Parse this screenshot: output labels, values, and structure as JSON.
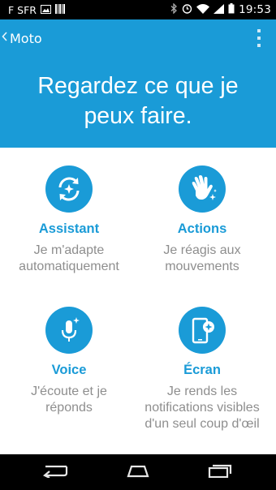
{
  "status_bar": {
    "carrier": "F SFR",
    "time": "19:53",
    "icons": [
      "image-icon",
      "barcode-icon",
      "bluetooth-icon",
      "alarm-icon",
      "wifi-icon",
      "signal-icon",
      "battery-icon"
    ]
  },
  "app_bar": {
    "title": "Moto",
    "back_icon": "chevron-left-icon",
    "menu_icon": "overflow-menu-icon"
  },
  "header": {
    "headline": "Regardez ce que je peux faire.",
    "background_color": "#1a9bd7"
  },
  "features": [
    {
      "title": "Assistant",
      "description": "Je m'adapte automatiquement",
      "icon": "sync-sparkle-icon"
    },
    {
      "title": "Actions",
      "description": "Je réagis aux mouvements",
      "icon": "wave-hand-icon"
    },
    {
      "title": "Voice",
      "description": "J'écoute et je réponds",
      "icon": "microphone-icon"
    },
    {
      "title": "Écran",
      "description": "Je rends les notifications visibles d'un seul coup d'œil",
      "icon": "phone-notification-icon"
    }
  ],
  "nav_bar": {
    "buttons": [
      "back-icon",
      "home-icon",
      "recents-icon"
    ]
  },
  "accent_color": "#1a9bd7"
}
